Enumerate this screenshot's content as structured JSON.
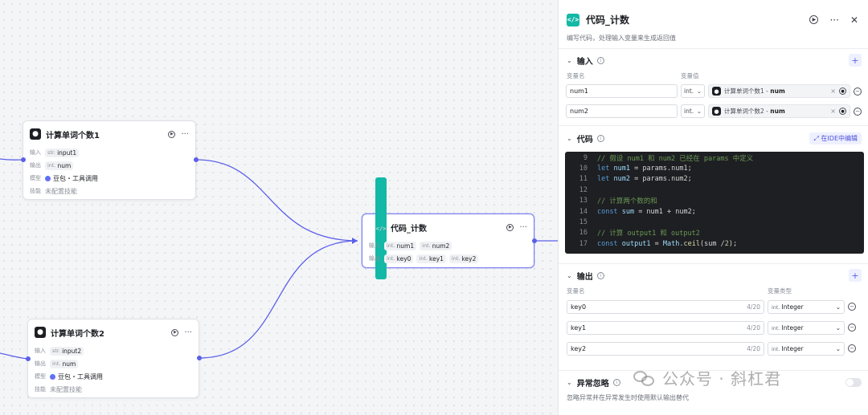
{
  "nodes": {
    "count1": {
      "title": "计算单词个数1",
      "input_label": "输入",
      "input_type": "str.",
      "input_name": "input1",
      "output_label": "输出",
      "output_type": "int.",
      "output_name": "num",
      "model_label": "模型",
      "model_value": "豆包・工具调用",
      "skill_label": "技能",
      "skill_value": "未配置技能"
    },
    "count2": {
      "title": "计算单词个数2",
      "input_label": "输入",
      "input_type": "str.",
      "input_name": "input2",
      "output_label": "输出",
      "output_type": "int.",
      "output_name": "num",
      "model_label": "模型",
      "model_value": "豆包・工具调用",
      "skill_label": "技能",
      "skill_value": "未配置技能"
    },
    "code": {
      "title": "代码_计数",
      "input_label": "输入",
      "inputs": [
        {
          "type": "int.",
          "name": "num1"
        },
        {
          "type": "int.",
          "name": "num2"
        }
      ],
      "output_label": "输出",
      "outputs": [
        {
          "type": "int.",
          "name": "key0"
        },
        {
          "type": "int.",
          "name": "key1"
        },
        {
          "type": "int.",
          "name": "key2"
        }
      ]
    }
  },
  "panel": {
    "title": "代码_计数",
    "description": "编写代码，处理输入变量来生成返回值",
    "input_section": {
      "title": "输入",
      "col_name": "变量名",
      "col_value": "变量值",
      "rows": [
        {
          "name": "num1",
          "type": "int.",
          "ref_node": "计算单词个数1",
          "ref_sep": " - ",
          "ref_var": "num"
        },
        {
          "name": "num2",
          "type": "int.",
          "ref_node": "计算单词个数2",
          "ref_sep": " - ",
          "ref_var": "num"
        }
      ]
    },
    "code_section": {
      "title": "代码",
      "ide_button": "在IDE中编辑",
      "lines": [
        {
          "n": "9"
        },
        {
          "n": "10"
        },
        {
          "n": "11"
        },
        {
          "n": "12"
        },
        {
          "n": "13"
        },
        {
          "n": "14"
        },
        {
          "n": "15"
        },
        {
          "n": "16"
        },
        {
          "n": "17"
        }
      ],
      "l9": "// 假设 num1 和 num2 已经在 params 中定义",
      "l10_kw": "let",
      "l10_var": "num1",
      "l10_rest": " = params.num1;",
      "l11_kw": "let",
      "l11_var": "num2",
      "l11_rest": " = params.num2;",
      "l13": "// 计算两个数的和",
      "l14_kw": "const",
      "l14_var": "sum",
      "l14_rest": " = num1 + num2;",
      "l16": "// 计算 output1 和 output2",
      "l17_kw": "const",
      "l17_var": "output1",
      "l17_eq": " = ",
      "l17_obj": "Math.",
      "l17_fn": "ceil",
      "l17_rest": "(sum / ",
      "l17_num": "2",
      "l17_end": ");"
    },
    "output_section": {
      "title": "输出",
      "col_name": "变量名",
      "col_type": "变量类型",
      "rows": [
        {
          "name": "key0",
          "count": "4/20",
          "type_tag": "int.",
          "type": "Integer"
        },
        {
          "name": "key1",
          "count": "4/20",
          "type_tag": "int.",
          "type": "Integer"
        },
        {
          "name": "key2",
          "count": "4/20",
          "type_tag": "int.",
          "type": "Integer"
        }
      ]
    },
    "error_section": {
      "title": "异常忽略",
      "description": "忽略异常并在异常发生时使用默认输出替代"
    }
  },
  "watermark": "公众号 · 斜杠君"
}
